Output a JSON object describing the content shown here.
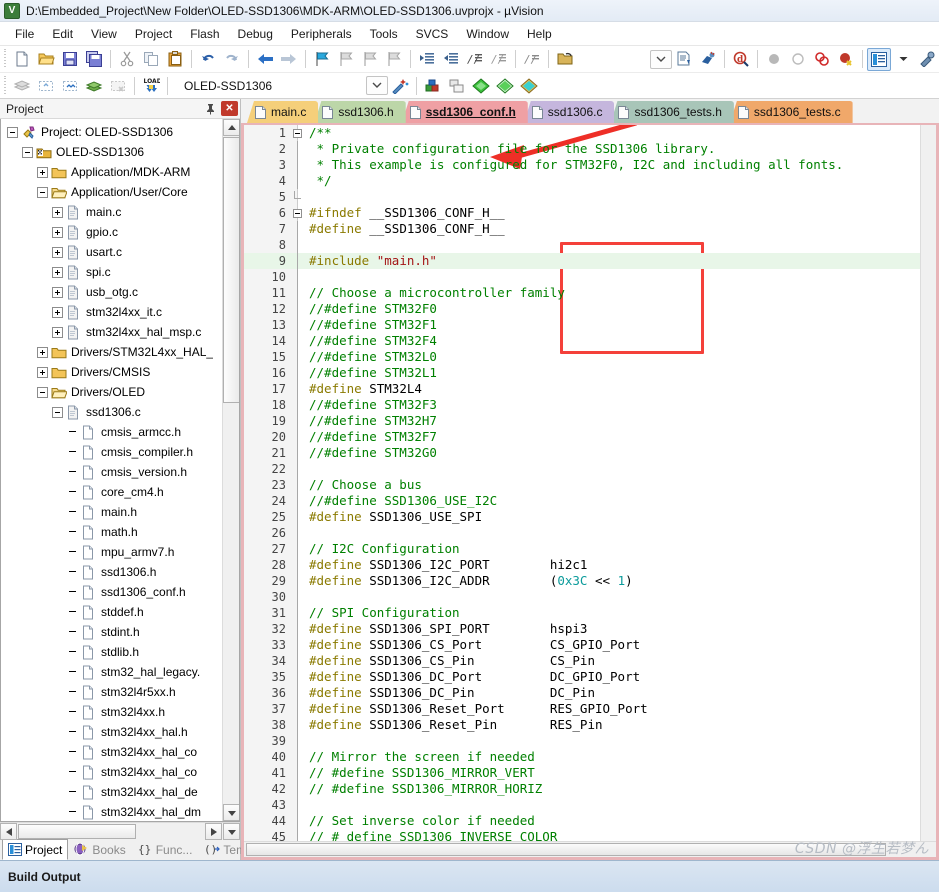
{
  "window": {
    "title": "D:\\Embedded_Project\\New Folder\\OLED-SSD1306\\MDK-ARM\\OLED-SSD1306.uvprojx - µVision",
    "app_icon": "uvision-icon"
  },
  "menu": {
    "items": [
      "File",
      "Edit",
      "View",
      "Project",
      "Flash",
      "Debug",
      "Peripherals",
      "Tools",
      "SVCS",
      "Window",
      "Help"
    ]
  },
  "toolbar": {
    "target_name": "OLED-SSD1306",
    "row1_icons": [
      "new-file-icon",
      "open-folder-icon",
      "save-icon",
      "save-all-icon",
      "cut-icon",
      "copy-icon",
      "paste-icon",
      "undo-icon",
      "redo-icon",
      "navigate-back-icon",
      "navigate-forward-icon",
      "bookmark-toggle-icon",
      "bookmark-prev-icon",
      "bookmark-next-icon",
      "bookmark-clear-icon",
      "indent-icon",
      "outdent-icon",
      "comment-icon",
      "uncomment-icon",
      "uncomment-all-icon",
      "open-file-icon"
    ],
    "row2_icons": [
      "build-icon",
      "rebuild-icon",
      "batch-build-icon",
      "translate-icon",
      "stop-build-icon",
      "load-icon"
    ],
    "row2_right_icons": [
      "target-options-icon",
      "configuration-wizard-icon",
      "manage-components-icon",
      "multi-project-icon",
      "pack-installer-icon",
      "pack-installer-2-icon",
      "pack-installer-3-icon"
    ],
    "right_icons": [
      "chevron-down-icon",
      "insert-file-icon",
      "debug-icon",
      "find-in-files-icon",
      "breakpoint-icon",
      "breakpoint-disabled-icon",
      "breakpoint-toggle-icon",
      "breakpoint-kill-icon",
      "project-window-icon",
      "dropdown-arrow-icon",
      "tools-icon"
    ]
  },
  "project_panel": {
    "caption": "Project",
    "pin_icon": "pin-icon",
    "close_icon": "close-icon",
    "tree": [
      {
        "label": "Project: OLED-SSD1306",
        "indent": 0,
        "expander": "minus",
        "icon": "project-icon"
      },
      {
        "label": "OLED-SSD1306",
        "indent": 1,
        "expander": "minus",
        "icon": "target-icon"
      },
      {
        "label": "Application/MDK-ARM",
        "indent": 2,
        "expander": "plus",
        "icon": "folder-closed-icon"
      },
      {
        "label": "Application/User/Core",
        "indent": 2,
        "expander": "minus",
        "icon": "folder-open-icon"
      },
      {
        "label": "main.c",
        "indent": 3,
        "expander": "plus",
        "icon": "c-file-icon"
      },
      {
        "label": "gpio.c",
        "indent": 3,
        "expander": "plus",
        "icon": "c-file-icon"
      },
      {
        "label": "usart.c",
        "indent": 3,
        "expander": "plus",
        "icon": "c-file-icon"
      },
      {
        "label": "spi.c",
        "indent": 3,
        "expander": "plus",
        "icon": "c-file-icon"
      },
      {
        "label": "usb_otg.c",
        "indent": 3,
        "expander": "plus",
        "icon": "c-file-icon"
      },
      {
        "label": "stm32l4xx_it.c",
        "indent": 3,
        "expander": "plus",
        "icon": "c-file-icon"
      },
      {
        "label": "stm32l4xx_hal_msp.c",
        "indent": 3,
        "expander": "plus",
        "icon": "c-file-icon"
      },
      {
        "label": "Drivers/STM32L4xx_HAL_",
        "indent": 2,
        "expander": "plus",
        "icon": "folder-closed-icon"
      },
      {
        "label": "Drivers/CMSIS",
        "indent": 2,
        "expander": "plus",
        "icon": "folder-closed-icon"
      },
      {
        "label": "Drivers/OLED",
        "indent": 2,
        "expander": "minus",
        "icon": "folder-open-icon"
      },
      {
        "label": "ssd1306.c",
        "indent": 3,
        "expander": "minus",
        "icon": "c-file-icon"
      },
      {
        "label": "cmsis_armcc.h",
        "indent": 4,
        "expander": "none",
        "icon": "h-file-icon"
      },
      {
        "label": "cmsis_compiler.h",
        "indent": 4,
        "expander": "none",
        "icon": "h-file-icon"
      },
      {
        "label": "cmsis_version.h",
        "indent": 4,
        "expander": "none",
        "icon": "h-file-icon"
      },
      {
        "label": "core_cm4.h",
        "indent": 4,
        "expander": "none",
        "icon": "h-file-icon"
      },
      {
        "label": "main.h",
        "indent": 4,
        "expander": "none",
        "icon": "h-file-icon"
      },
      {
        "label": "math.h",
        "indent": 4,
        "expander": "none",
        "icon": "h-file-icon"
      },
      {
        "label": "mpu_armv7.h",
        "indent": 4,
        "expander": "none",
        "icon": "h-file-icon"
      },
      {
        "label": "ssd1306.h",
        "indent": 4,
        "expander": "none",
        "icon": "h-file-icon"
      },
      {
        "label": "ssd1306_conf.h",
        "indent": 4,
        "expander": "none",
        "icon": "h-file-icon"
      },
      {
        "label": "stddef.h",
        "indent": 4,
        "expander": "none",
        "icon": "h-file-icon"
      },
      {
        "label": "stdint.h",
        "indent": 4,
        "expander": "none",
        "icon": "h-file-icon"
      },
      {
        "label": "stdlib.h",
        "indent": 4,
        "expander": "none",
        "icon": "h-file-icon"
      },
      {
        "label": "stm32_hal_legacy.",
        "indent": 4,
        "expander": "none",
        "icon": "h-file-icon"
      },
      {
        "label": "stm32l4r5xx.h",
        "indent": 4,
        "expander": "none",
        "icon": "h-file-icon"
      },
      {
        "label": "stm32l4xx.h",
        "indent": 4,
        "expander": "none",
        "icon": "h-file-icon"
      },
      {
        "label": "stm32l4xx_hal.h",
        "indent": 4,
        "expander": "none",
        "icon": "h-file-icon"
      },
      {
        "label": "stm32l4xx_hal_co",
        "indent": 4,
        "expander": "none",
        "icon": "h-file-icon"
      },
      {
        "label": "stm32l4xx_hal_co",
        "indent": 4,
        "expander": "none",
        "icon": "h-file-icon"
      },
      {
        "label": "stm32l4xx_hal_de",
        "indent": 4,
        "expander": "none",
        "icon": "h-file-icon"
      },
      {
        "label": "stm32l4xx_hal_dm",
        "indent": 4,
        "expander": "none",
        "icon": "h-file-icon"
      }
    ],
    "bottom_tabs": [
      {
        "label": "Project",
        "icon": "project-tab-icon",
        "selected": true
      },
      {
        "label": "Books",
        "icon": "books-tab-icon",
        "selected": false
      },
      {
        "label": "Func...",
        "icon": "functions-tab-icon",
        "selected": false
      },
      {
        "label": "Temp...",
        "icon": "templates-tab-icon",
        "selected": false
      }
    ]
  },
  "editor": {
    "tabs": [
      {
        "label": "main.c",
        "color": "#f5cf7a",
        "selected": false
      },
      {
        "label": "ssd1306.h",
        "color": "#bcd6a8",
        "selected": false
      },
      {
        "label": "ssd1306_conf.h",
        "color": "#efa0a4",
        "selected": true
      },
      {
        "label": "ssd1306.c",
        "color": "#c5b6dd",
        "selected": false
      },
      {
        "label": "ssd1306_tests.h",
        "color": "#a8c5b8",
        "selected": false
      },
      {
        "label": "ssd1306_tests.c",
        "color": "#f0a86a",
        "selected": false
      }
    ],
    "highlighted_line": 9,
    "lines": [
      {
        "n": 1,
        "fold": "start",
        "segs": [
          {
            "t": "/**",
            "c": "cm"
          }
        ]
      },
      {
        "n": 2,
        "fold": "bar",
        "segs": [
          {
            "t": " * Private configuration file for the SSD1306 library.",
            "c": "cm"
          }
        ]
      },
      {
        "n": 3,
        "fold": "bar",
        "segs": [
          {
            "t": " * This example is configured for STM32F0, I2C and including all fonts.",
            "c": "cm"
          }
        ]
      },
      {
        "n": 4,
        "fold": "bar",
        "segs": [
          {
            "t": " */",
            "c": "cm"
          }
        ]
      },
      {
        "n": 5,
        "fold": "end",
        "segs": []
      },
      {
        "n": 6,
        "fold": "start",
        "segs": [
          {
            "t": "#ifndef",
            "c": "pp"
          },
          {
            "t": " __SSD1306_CONF_H__",
            "c": "id"
          }
        ]
      },
      {
        "n": 7,
        "fold": "bar",
        "segs": [
          {
            "t": "#define",
            "c": "pp"
          },
          {
            "t": " __SSD1306_CONF_H__",
            "c": "id"
          }
        ]
      },
      {
        "n": 8,
        "fold": "bar",
        "segs": []
      },
      {
        "n": 9,
        "fold": "bar",
        "segs": [
          {
            "t": "#include",
            "c": "pp"
          },
          {
            "t": " ",
            "c": "id"
          },
          {
            "t": "\"main.h\"",
            "c": "str"
          }
        ]
      },
      {
        "n": 10,
        "fold": "bar",
        "segs": []
      },
      {
        "n": 11,
        "fold": "bar",
        "segs": [
          {
            "t": "// Choose a microcontroller family",
            "c": "cm"
          }
        ]
      },
      {
        "n": 12,
        "fold": "bar",
        "segs": [
          {
            "t": "//#define STM32F0",
            "c": "cm"
          }
        ]
      },
      {
        "n": 13,
        "fold": "bar",
        "segs": [
          {
            "t": "//#define STM32F1",
            "c": "cm"
          }
        ]
      },
      {
        "n": 14,
        "fold": "bar",
        "segs": [
          {
            "t": "//#define STM32F4",
            "c": "cm"
          }
        ]
      },
      {
        "n": 15,
        "fold": "bar",
        "segs": [
          {
            "t": "//#define STM32L0",
            "c": "cm"
          }
        ]
      },
      {
        "n": 16,
        "fold": "bar",
        "segs": [
          {
            "t": "//#define STM32L1",
            "c": "cm"
          }
        ]
      },
      {
        "n": 17,
        "fold": "bar",
        "segs": [
          {
            "t": "#define",
            "c": "pp"
          },
          {
            "t": " STM32L4",
            "c": "id"
          }
        ]
      },
      {
        "n": 18,
        "fold": "bar",
        "segs": [
          {
            "t": "//#define STM32F3",
            "c": "cm"
          }
        ]
      },
      {
        "n": 19,
        "fold": "bar",
        "segs": [
          {
            "t": "//#define STM32H7",
            "c": "cm"
          }
        ]
      },
      {
        "n": 20,
        "fold": "bar",
        "segs": [
          {
            "t": "//#define STM32F7",
            "c": "cm"
          }
        ]
      },
      {
        "n": 21,
        "fold": "bar",
        "segs": [
          {
            "t": "//#define STM32G0",
            "c": "cm"
          }
        ]
      },
      {
        "n": 22,
        "fold": "bar",
        "segs": []
      },
      {
        "n": 23,
        "fold": "bar",
        "segs": [
          {
            "t": "// Choose a bus",
            "c": "cm"
          }
        ]
      },
      {
        "n": 24,
        "fold": "bar",
        "segs": [
          {
            "t": "//#define SSD1306_USE_I2C",
            "c": "cm"
          }
        ]
      },
      {
        "n": 25,
        "fold": "bar",
        "segs": [
          {
            "t": "#define",
            "c": "pp"
          },
          {
            "t": " SSD1306_USE_SPI",
            "c": "id"
          }
        ]
      },
      {
        "n": 26,
        "fold": "bar",
        "segs": []
      },
      {
        "n": 27,
        "fold": "bar",
        "segs": [
          {
            "t": "// I2C Configuration",
            "c": "cm"
          }
        ]
      },
      {
        "n": 28,
        "fold": "bar",
        "segs": [
          {
            "t": "#define",
            "c": "pp"
          },
          {
            "t": " SSD1306_I2C_PORT        hi2c1",
            "c": "id"
          }
        ]
      },
      {
        "n": 29,
        "fold": "bar",
        "segs": [
          {
            "t": "#define",
            "c": "pp"
          },
          {
            "t": " SSD1306_I2C_ADDR        (",
            "c": "id"
          },
          {
            "t": "0x3C",
            "c": "num"
          },
          {
            "t": " << ",
            "c": "id"
          },
          {
            "t": "1",
            "c": "num"
          },
          {
            "t": ")",
            "c": "id"
          }
        ]
      },
      {
        "n": 30,
        "fold": "bar",
        "segs": []
      },
      {
        "n": 31,
        "fold": "bar",
        "segs": [
          {
            "t": "// SPI Configuration",
            "c": "cm"
          }
        ]
      },
      {
        "n": 32,
        "fold": "bar",
        "segs": [
          {
            "t": "#define",
            "c": "pp"
          },
          {
            "t": " SSD1306_SPI_PORT        hspi3",
            "c": "id"
          }
        ]
      },
      {
        "n": 33,
        "fold": "bar",
        "segs": [
          {
            "t": "#define",
            "c": "pp"
          },
          {
            "t": " SSD1306_CS_Port         CS_GPIO_Port",
            "c": "id"
          }
        ]
      },
      {
        "n": 34,
        "fold": "bar",
        "segs": [
          {
            "t": "#define",
            "c": "pp"
          },
          {
            "t": " SSD1306_CS_Pin          CS_Pin",
            "c": "id"
          }
        ]
      },
      {
        "n": 35,
        "fold": "bar",
        "segs": [
          {
            "t": "#define",
            "c": "pp"
          },
          {
            "t": " SSD1306_DC_Port         DC_GPIO_Port",
            "c": "id"
          }
        ]
      },
      {
        "n": 36,
        "fold": "bar",
        "segs": [
          {
            "t": "#define",
            "c": "pp"
          },
          {
            "t": " SSD1306_DC_Pin          DC_Pin",
            "c": "id"
          }
        ]
      },
      {
        "n": 37,
        "fold": "bar",
        "segs": [
          {
            "t": "#define",
            "c": "pp"
          },
          {
            "t": " SSD1306_Reset_Port      RES_GPIO_Port",
            "c": "id"
          }
        ]
      },
      {
        "n": 38,
        "fold": "bar",
        "segs": [
          {
            "t": "#define",
            "c": "pp"
          },
          {
            "t": " SSD1306_Reset_Pin       RES_Pin",
            "c": "id"
          }
        ]
      },
      {
        "n": 39,
        "fold": "bar",
        "segs": []
      },
      {
        "n": 40,
        "fold": "bar",
        "segs": [
          {
            "t": "// Mirror the screen if needed",
            "c": "cm"
          }
        ]
      },
      {
        "n": 41,
        "fold": "bar",
        "segs": [
          {
            "t": "// #define SSD1306_MIRROR_VERT",
            "c": "cm"
          }
        ]
      },
      {
        "n": 42,
        "fold": "bar",
        "segs": [
          {
            "t": "// #define SSD1306_MIRROR_HORIZ",
            "c": "cm"
          }
        ]
      },
      {
        "n": 43,
        "fold": "bar",
        "segs": []
      },
      {
        "n": 44,
        "fold": "bar",
        "segs": [
          {
            "t": "// Set inverse color if needed",
            "c": "cm"
          }
        ]
      },
      {
        "n": 45,
        "fold": "bar",
        "segs": [
          {
            "t": "// # define SSD1306 INVERSE COLOR",
            "c": "cm"
          }
        ]
      }
    ],
    "annotations": {
      "arrow": {
        "color": "#ee2f27",
        "points_to_line": 9,
        "label": "red-arrow-annotation"
      },
      "box": {
        "color": "#f4403a",
        "covers_lines": "32-38",
        "label": "red-box-annotation"
      }
    }
  },
  "build_output": {
    "title": "Build Output"
  },
  "watermark": {
    "text": "CSDN @浮生若梦ん"
  },
  "colors": {
    "comment_green": "#008000",
    "preprocessor_yellow": "#8a7a00",
    "string_red": "#a31515",
    "number_teal": "#0b9b9b",
    "highlight_line": "#e8f6e8",
    "annotation_red": "#f4403a"
  }
}
